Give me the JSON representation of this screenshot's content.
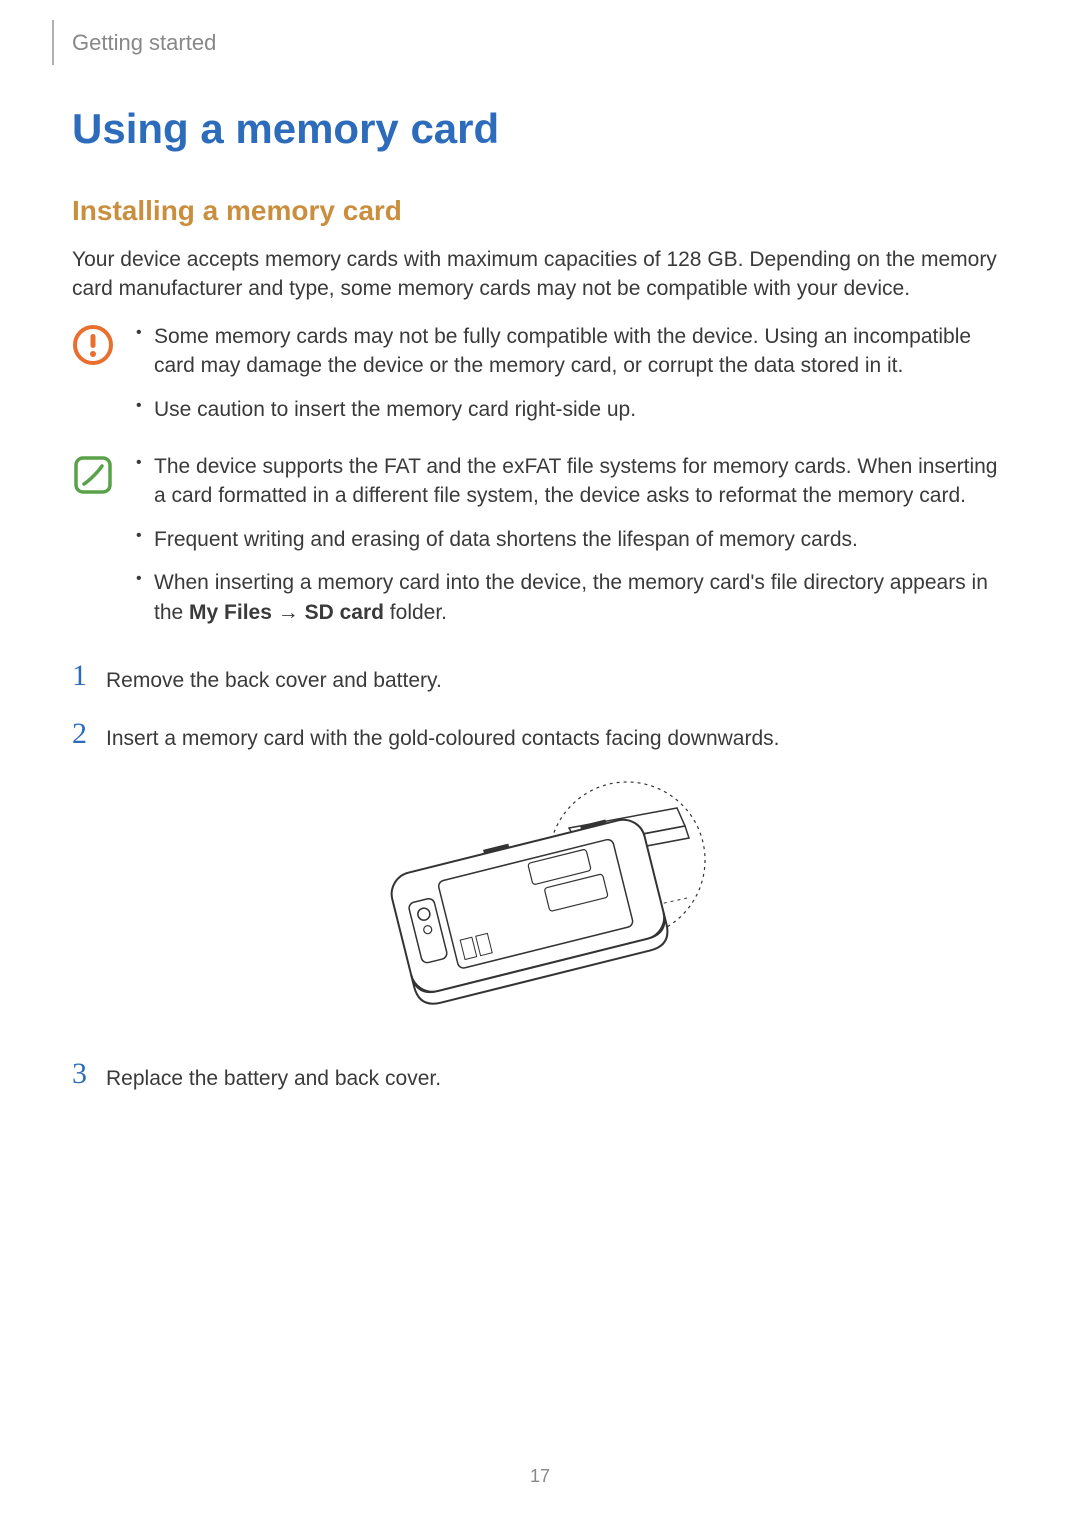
{
  "header": {
    "section": "Getting started"
  },
  "title": "Using a memory card",
  "subtitle": "Installing a memory card",
  "intro": "Your device accepts memory cards with maximum capacities of 128 GB. Depending on the memory card manufacturer and type, some memory cards may not be compatible with your device.",
  "callouts": [
    {
      "icon": "caution",
      "items": [
        "Some memory cards may not be fully compatible with the device. Using an incompatible card may damage the device or the memory card, or corrupt the data stored in it.",
        "Use caution to insert the memory card right-side up."
      ]
    },
    {
      "icon": "note",
      "items": [
        "The device supports the FAT and the exFAT file systems for memory cards. When inserting a card formatted in a different file system, the device asks to reformat the memory card.",
        "Frequent writing and erasing of data shortens the lifespan of memory cards.",
        "When inserting a memory card into the device, the memory card's file directory appears in the "
      ],
      "path_prefix": "My Files",
      "path_arrow": "→",
      "path_suffix": "SD card",
      "path_tail": " folder."
    }
  ],
  "steps": [
    {
      "num": "1",
      "text": "Remove the back cover and battery."
    },
    {
      "num": "2",
      "text": "Insert a memory card with the gold-coloured contacts facing downwards."
    },
    {
      "num": "3",
      "text": "Replace the battery and back cover."
    }
  ],
  "page_number": "17"
}
